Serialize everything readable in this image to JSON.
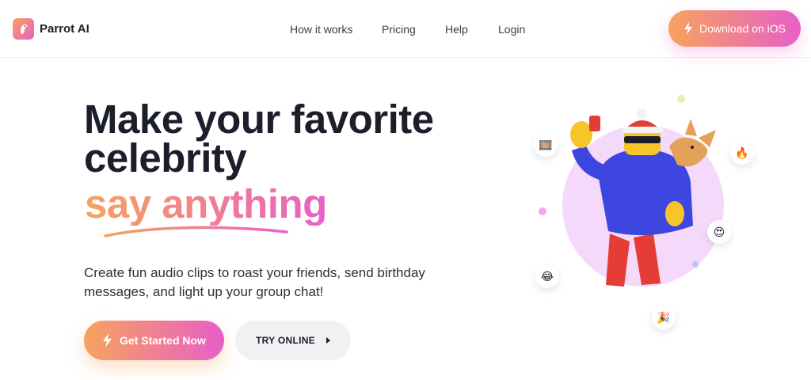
{
  "brand": {
    "name": "Parrot AI",
    "colors": {
      "gradient_start": "#f6a35d",
      "gradient_end": "#e85fc8",
      "text": "#1c1f2b",
      "secondary_button_bg": "#f1f1f3",
      "illustration_circle": "#f4d9fb"
    }
  },
  "nav": {
    "items": [
      {
        "label": "How it works"
      },
      {
        "label": "Pricing"
      },
      {
        "label": "Help"
      },
      {
        "label": "Login"
      }
    ],
    "cta": {
      "label": "Download on iOS",
      "icon": "lightning-icon"
    }
  },
  "hero": {
    "title_lines": [
      "Make your favorite",
      "celebrity"
    ],
    "title_accent": "say anything",
    "subtitle": "Create fun audio clips to roast your friends, send birthday messages, and light up your group chat!",
    "primary_cta": {
      "label": "Get Started Now",
      "icon": "lightning-icon"
    },
    "secondary_cta": {
      "label": "TRY ONLINE",
      "icon": "play-caret-icon"
    }
  },
  "illustration": {
    "subject": "character-taking-selfie-with-dog",
    "emoji_bubbles": [
      {
        "icon": "film-icon",
        "glyph": "🎞️"
      },
      {
        "icon": "fire-icon",
        "glyph": "🔥"
      },
      {
        "icon": "heart-eyes-icon",
        "glyph": "😍"
      },
      {
        "icon": "laughing-icon",
        "glyph": "😂"
      },
      {
        "icon": "party-popper-icon",
        "glyph": "🎉"
      }
    ]
  }
}
